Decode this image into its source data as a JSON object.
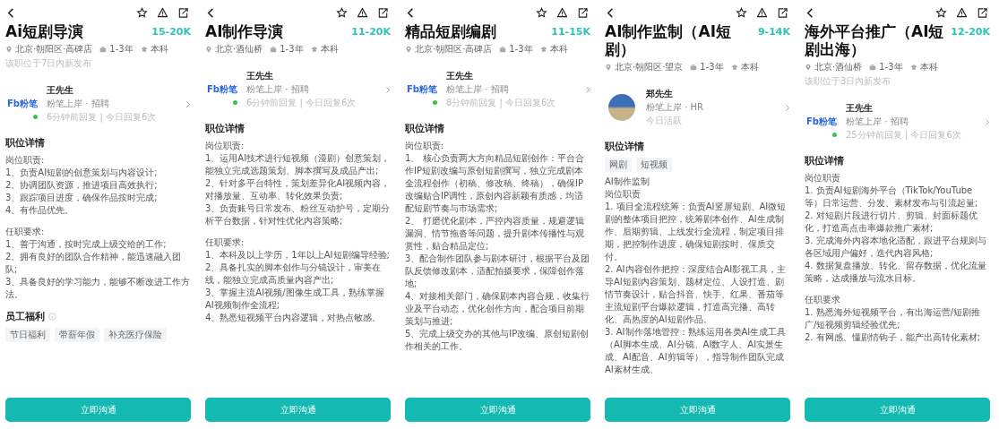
{
  "panels": [
    {
      "title": "Ai短剧导演",
      "salary": "15-20K",
      "meta": {
        "location": "北京·朝阳区·高碑店",
        "experience": "1-3年",
        "education": "本科"
      },
      "note": "该职位于7日内新发布",
      "recruiter": {
        "kind": "logo",
        "logo_text": "Fb粉笔",
        "online": true,
        "name": "王先生",
        "company_role": "粉笔上岸 · 招聘",
        "activity": "6分钟前回复 | 今日回复6次"
      },
      "section_title": "职位详情",
      "blocks": [
        [
          "岗位职责:",
          "1、负责AI短剧的创意策划与内容设计;",
          "2、协调团队资源，推进项目高效执行;",
          "3、跟踪项目进度，确保作品按时完成;",
          "4、有作品优先。"
        ],
        [
          "任职要求:",
          "1、善于沟通，按时完成上级交给的工作;",
          "2、拥有良好的团队合作精神，能迅速融入团队;",
          "3、具备良好的学习能力，能够不断改进工作方法。"
        ]
      ],
      "benefits": {
        "title": "员工福利",
        "tags": [
          "节日福利",
          "带薪年假",
          "补充医疗保险"
        ]
      },
      "button": "立即沟通"
    },
    {
      "title": "AI制作导演",
      "salary": "11-20K",
      "meta": {
        "location": "北京·酒仙桥",
        "experience": "1-3年",
        "education": "本科"
      },
      "recruiter": {
        "kind": "logo",
        "logo_text": "Fb粉笔",
        "online": true,
        "name": "王先生",
        "company_role": "粉笔上岸 · 招聘",
        "activity": "6分钟前回复 | 今日回复6次"
      },
      "section_title": "职位详情",
      "blocks": [
        [
          "岗位职责:",
          "1、运用AI技术进行短视频（漫剧）创意策划，能独立完成选题策划、脚本撰写及成品产出;",
          "2、针对多平台特性，策划差异化AI视频内容，对播放量、互动率、转化效果负责;",
          "3、负责账号日常发布、粉丝互动护号，定期分析平台数据，针对性优化内容策略;"
        ],
        [
          "任职要求:",
          "1、本科及以上学历，1年以上AI短剧编导经验;",
          "2、具备扎实的脚本创作与分镜设计，审美在线，能独立完成高质量内容产出;",
          "3、掌握主流AI视频/图像生成工具，熟练掌握AI视频制作全流程;",
          "4、熟悉短视频平台内容逻辑，对热点敏感。"
        ]
      ],
      "button": "立即沟通"
    },
    {
      "title": "精品短剧编剧",
      "salary": "11-15K",
      "meta": {
        "location": "北京·朝阳区·高碑店",
        "experience": "1-3年",
        "education": "本科"
      },
      "recruiter": {
        "kind": "logo",
        "logo_text": "Fb粉笔",
        "online": true,
        "name": "王先生",
        "company_role": "粉笔上岸 · 招聘",
        "activity": "8分钟前回复 | 今日回复6次"
      },
      "section_title": "职位详情",
      "blocks": [
        [
          "岗位职责:",
          "1、 核心负责两大方向精品短剧创作：平台合作IP短剧改编与原创短剧撰写，独立完成剧本全流程创作（初稿、修改稿、终稿），确保IP改编贴合IP调性，原创内容新颖有质感，均适配短剧节奏与市场需求;",
          "2、 打磨优化剧本，严控内容质量，规避逻辑漏洞、情节拖沓等问题，提升剧本传播性与观赏性，贴合精品定位;",
          "3、配合制作团队参与剧本研讨，根据平台及团队反馈修改剧本，适配拍摄要求，保障创作落地;",
          "4、对接相关部门，确保剧本内容合规，收集行业及平台动态，优化创作方向，配合项目前期策划与推进;",
          "5、完成上级交办的其他与IP改编、原创短剧创作相关的工作。"
        ]
      ],
      "button": "立即沟通"
    },
    {
      "title": "AI制作监制（AI短剧）",
      "salary": "9-14K",
      "meta": {
        "location": "北京·朝阳区·望京",
        "experience": "1-3年",
        "education": "本科"
      },
      "recruiter": {
        "kind": "photo",
        "online": false,
        "name": "郑先生",
        "company_role": "粉笔上岸 · HR",
        "activity": "今日活跃"
      },
      "section_title": "职位详情",
      "tags": [
        "网剧",
        "短视频"
      ],
      "blocks": [
        [
          "AI制作监制",
          "岗位职责",
          "1. 项目全流程统筹：负责AI竖屏短剧、AI微短剧的整体项目把控，统筹剧本创作、AI生成制作、后期剪辑、上线发行全流程，制定项目排期，把控制作进度，确保短剧按时、保质交付。",
          "2. AI内容创作把控：深度结合AI影视工具，主导AI短剧内容策划、题材定位、人设打造、剧情节奏设计，贴合抖音、快手、红果、番茄等主流短剧平台爆款逻辑，打造高完播、高转化、高热度的AI短剧作品。",
          "3. AI制作落地管控：熟练运用各类AI生成工具（AI脚本生成、AI分镜、AI数字人、AI实景生成、AI配音、AI剪辑等），指导制作团队完成AI素材生成、"
        ]
      ],
      "button": "立即沟通"
    },
    {
      "title": "海外平台推广（AI短剧出海）",
      "salary": "12-20K",
      "meta": {
        "location": "北京·酒仙桥",
        "experience": "1-3年",
        "education": "本科"
      },
      "note": "该职位于3日内新发布",
      "recruiter": {
        "kind": "logo",
        "logo_text": "Fb粉笔",
        "online": true,
        "name": "王先生",
        "company_role": "粉笔上岸 · 招聘",
        "activity": "25分钟前回复 | 今日回复6次"
      },
      "section_title": "职位详情",
      "blocks": [
        [
          "岗位职责",
          "1. 负责AI短剧海外平台（TikTok/YouTube等）日常运营、分发、素材发布与引流起量;",
          "2. 对短剧片段进行切片、剪辑、封面标题优化，打造高点击率爆款推广素材;",
          "3. 完成海外内容本地化适配，跟进平台规则与各区域用户偏好，迭代内容风格;",
          "4. 数据复盘播放、转化、留存数据，优化流量策略，达成播放与流水目标。"
        ],
        [
          "任职要求",
          "1. 熟悉海外短视频平台，有出海运营/短剧推广/短视频剪辑经验优先;",
          "2. 有网感、懂剧情钩子，能产出高转化素材;"
        ]
      ],
      "button": "立即沟通"
    }
  ]
}
